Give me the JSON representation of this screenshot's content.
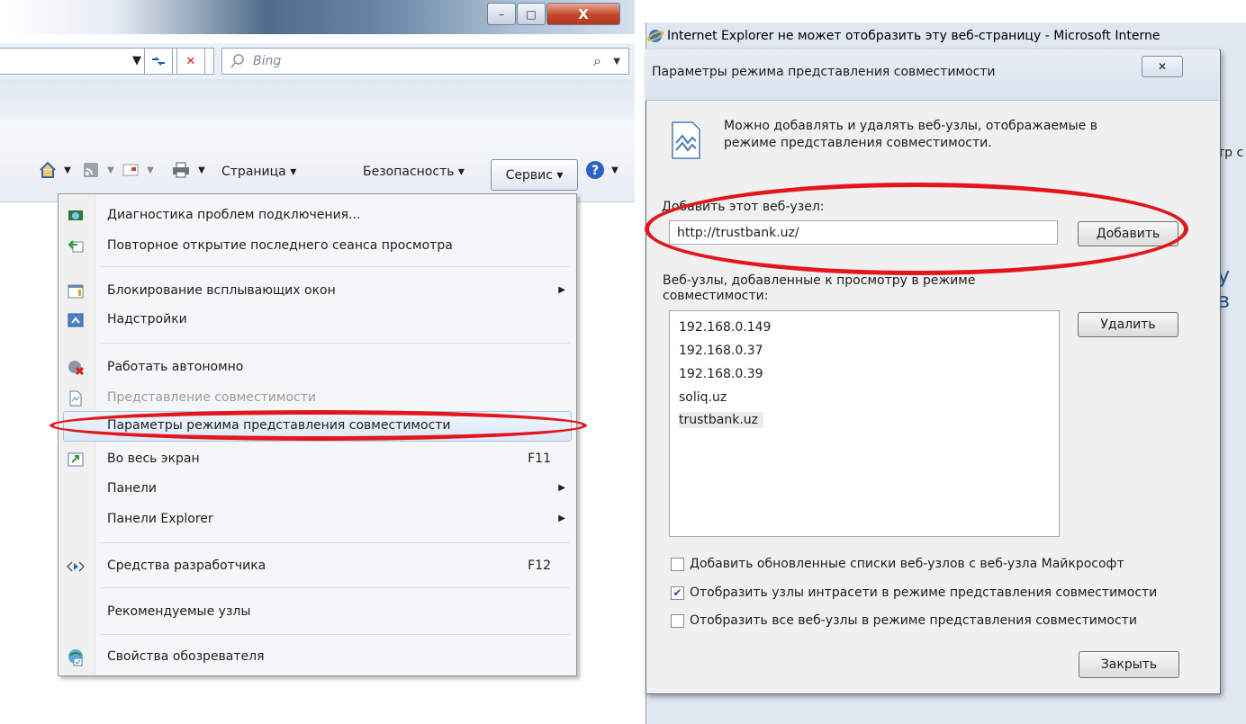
{
  "left": {
    "window_buttons": {
      "minimize": "–",
      "maximize": "□",
      "close": "X"
    },
    "search": {
      "placeholder": "Bing"
    },
    "command_bar": {
      "page_label": "Страница ▾",
      "security_label": "Безопасность ▾",
      "service_label": "Сервис ▾",
      "help": "?"
    },
    "menu": {
      "items": [
        {
          "label": "Диагностика проблем подключения...",
          "icon": "diagnostics-icon"
        },
        {
          "label": "Повторное открытие последнего сеанса просмотра",
          "icon": "reopen-icon"
        },
        {
          "label": "Блокирование всплывающих окон",
          "icon": "popup-blocker-icon",
          "submenu": true
        },
        {
          "label": "Надстройки",
          "icon": "addons-icon"
        },
        {
          "label": "Работать автономно",
          "icon": "offline-icon"
        },
        {
          "label": "Представление совместимости",
          "icon": "compat-icon",
          "disabled": true
        },
        {
          "label": "Параметры режима представления совместимости",
          "highlighted": true
        },
        {
          "label": "Во весь экран",
          "icon": "fullscreen-icon",
          "shortcut": "F11"
        },
        {
          "label": "Панели",
          "submenu": true
        },
        {
          "label": "Панели Explorer",
          "submenu": true
        },
        {
          "label": "Средства разработчика",
          "icon": "devtools-icon",
          "shortcut": "F12"
        },
        {
          "label": "Рекомендуемые узлы"
        },
        {
          "label": "Свойства обозревателя",
          "icon": "internet-options-icon"
        }
      ]
    }
  },
  "right": {
    "background_window_title": "Internet Explorer не может отобразить эту веб-страницу - Microsoft Interne",
    "background_fragment_1": "тр с",
    "background_fragment_2": "у в",
    "dialog": {
      "title": "Параметры режима представления совместимости",
      "close_label": "✕",
      "description": "Можно добавлять и удалять веб-узлы, отображаемые в режиме представления совместимости.",
      "add_label": "Добавить этот веб-узел:",
      "url_value": "http://trustbank.uz/",
      "add_button": "Добавить",
      "list_label": "Веб-узлы, добавленные к просмотру в режиме совместимости:",
      "sites": [
        "192.168.0.149",
        "192.168.0.37",
        "192.168.0.39",
        "soliq.uz",
        "trustbank.uz"
      ],
      "remove_button": "Удалить",
      "checkboxes": [
        {
          "label": "Добавить обновленные списки веб-узлов с веб-узла Майкрософт",
          "checked": false
        },
        {
          "label": "Отобразить узлы интрасети в режиме представления совместимости",
          "checked": true
        },
        {
          "label": "Отобразить все веб-узлы в режиме представления совместимости",
          "checked": false
        }
      ],
      "close_button": "Закрыть"
    }
  },
  "colors": {
    "annotation_red": "#e2161b"
  }
}
